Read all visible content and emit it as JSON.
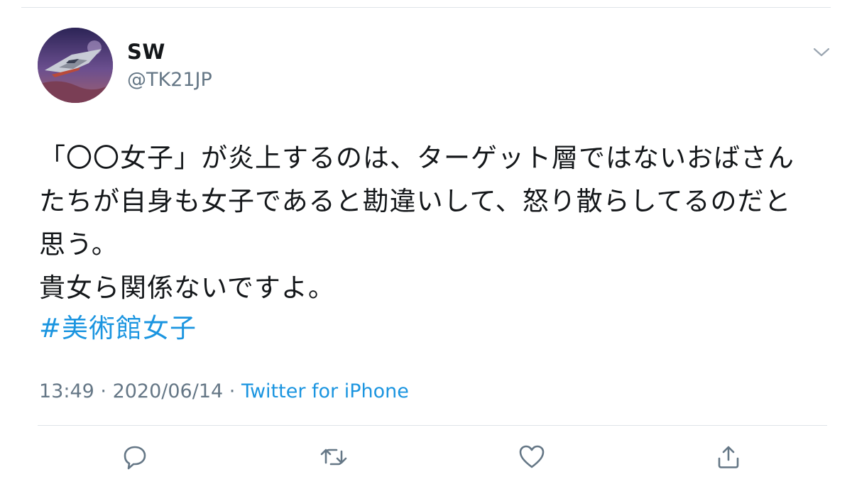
{
  "user": {
    "name": "SW",
    "handle": "@TK21JP"
  },
  "tweet": {
    "lines": [
      "「〇〇女子」が炎上するのは、ターゲット層ではないおばさん",
      "たちが自身も女子であると勘違いして、怒り散らしてるのだと",
      "思う。",
      "貴女ら関係ないですよ。"
    ],
    "hashtag": "#美術館女子"
  },
  "meta": {
    "time": "13:49",
    "separator1": " · ",
    "date": "2020/06/14",
    "separator2": " · ",
    "source": "Twitter for iPhone"
  },
  "actions": [
    "reply-icon",
    "retweet-icon",
    "like-icon",
    "share-icon"
  ],
  "colors": {
    "link": "#1b95e0",
    "secondary": "#657786",
    "text": "#14171a",
    "icon": "#657786"
  }
}
